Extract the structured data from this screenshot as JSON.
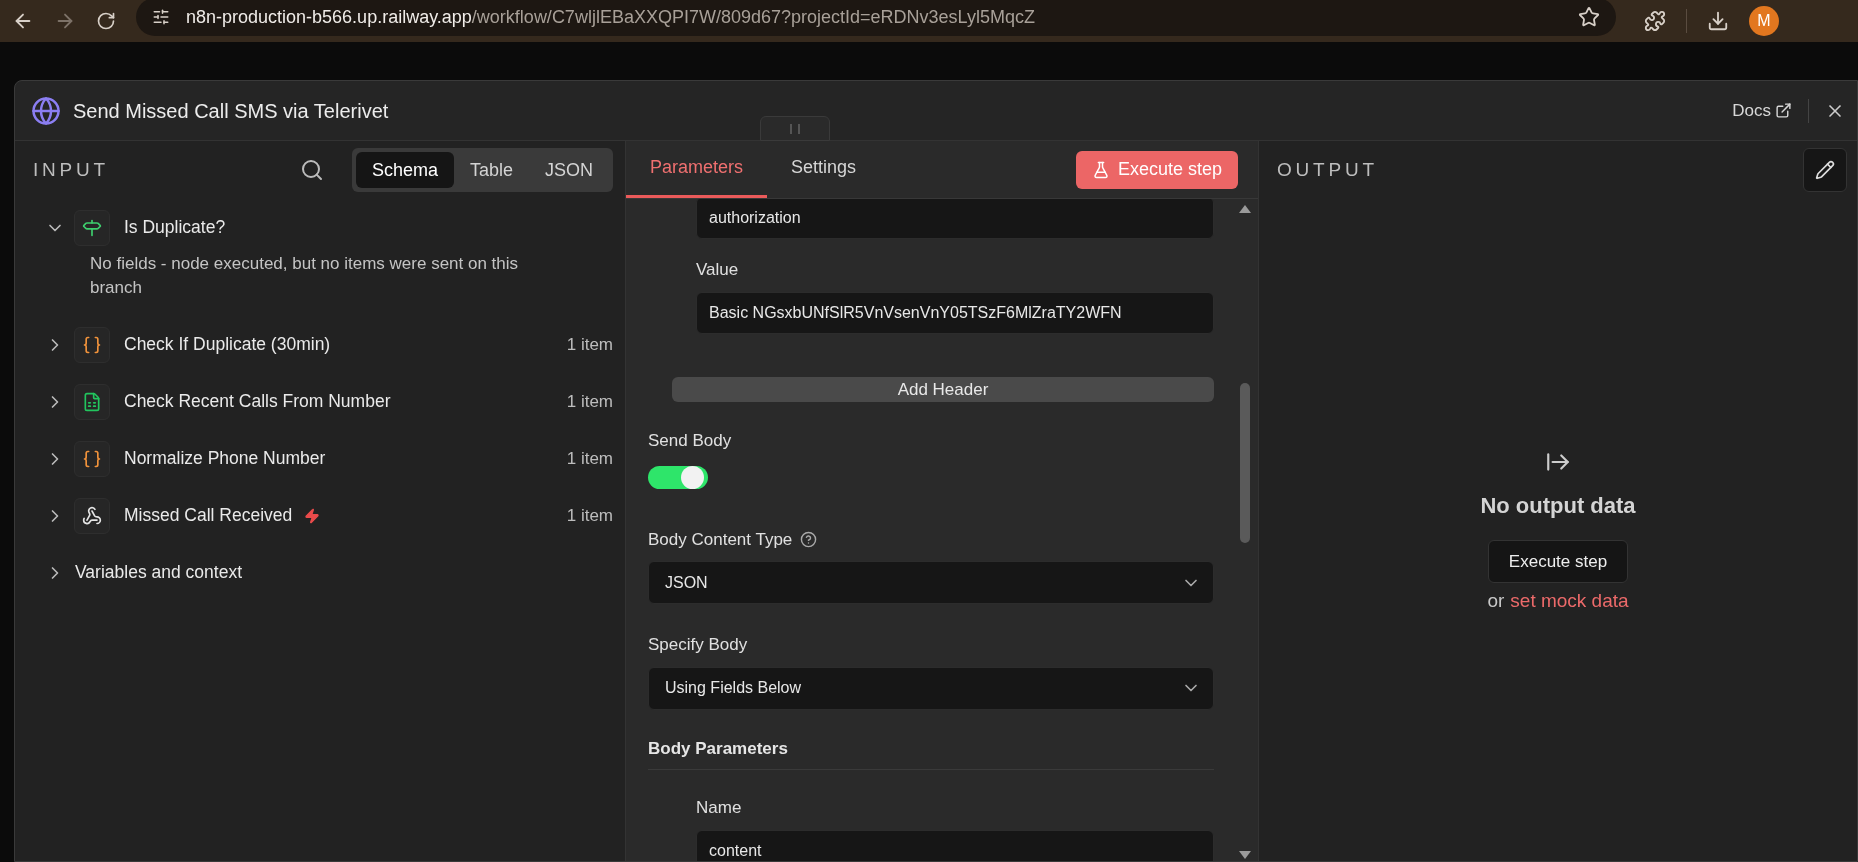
{
  "browser": {
    "url_host": "n8n-production-b566.up.railway.app",
    "url_path": "/workflow/C7wljlEBaXXQPI7W/809d67?projectId=eRDNv3esLyl5MqcZ",
    "avatar": "M"
  },
  "modal": {
    "title": "Send Missed Call SMS via Telerivet",
    "docs_link": "Docs"
  },
  "input": {
    "heading": "INPUT",
    "view_tabs": [
      {
        "label": "Schema",
        "selected": true
      },
      {
        "label": "Table",
        "selected": false
      },
      {
        "label": "JSON",
        "selected": false
      }
    ],
    "nodes": [
      {
        "name": "Is Duplicate?",
        "kind": "if",
        "expanded": true,
        "message": "No fields - node executed, but no items were sent on this branch",
        "trigger": false
      },
      {
        "name": "Check If Duplicate (30min)",
        "kind": "code",
        "expanded": false,
        "count": "1 item",
        "trigger": false
      },
      {
        "name": "Check Recent Calls From Number",
        "kind": "sheets",
        "expanded": false,
        "count": "1 item",
        "trigger": false
      },
      {
        "name": "Normalize Phone Number",
        "kind": "code",
        "expanded": false,
        "count": "1 item",
        "trigger": false
      },
      {
        "name": "Missed Call Received",
        "kind": "webhook",
        "expanded": false,
        "count": "1 item",
        "trigger": true
      }
    ],
    "variables": {
      "label": "Variables and context",
      "expanded": false
    }
  },
  "parameters": {
    "tabs": [
      {
        "label": "Parameters",
        "selected": true
      },
      {
        "label": "Settings",
        "selected": false
      }
    ],
    "execute_button": "Execute step",
    "header_fields": [
      {
        "value": "authorization"
      },
      {
        "label": "Value",
        "value": "Basic NGsxbUNfSlR5VnVsenVnY05TSzF6MlZraTY2WFN"
      }
    ],
    "add_header": "Add Header",
    "send_body": {
      "label": "Send Body",
      "on": true
    },
    "body_content_type": {
      "label": "Body Content Type",
      "value": "JSON"
    },
    "specify_body": {
      "label": "Specify Body",
      "value": "Using Fields Below"
    },
    "body_parameters": {
      "title": "Body Parameters",
      "fields": [
        {
          "label": "Name",
          "value": "content"
        }
      ]
    }
  },
  "output": {
    "heading": "OUTPUT",
    "empty_title": "No output data",
    "execute_button": "Execute step",
    "or_text": "or",
    "mock_link": "set mock data"
  }
}
